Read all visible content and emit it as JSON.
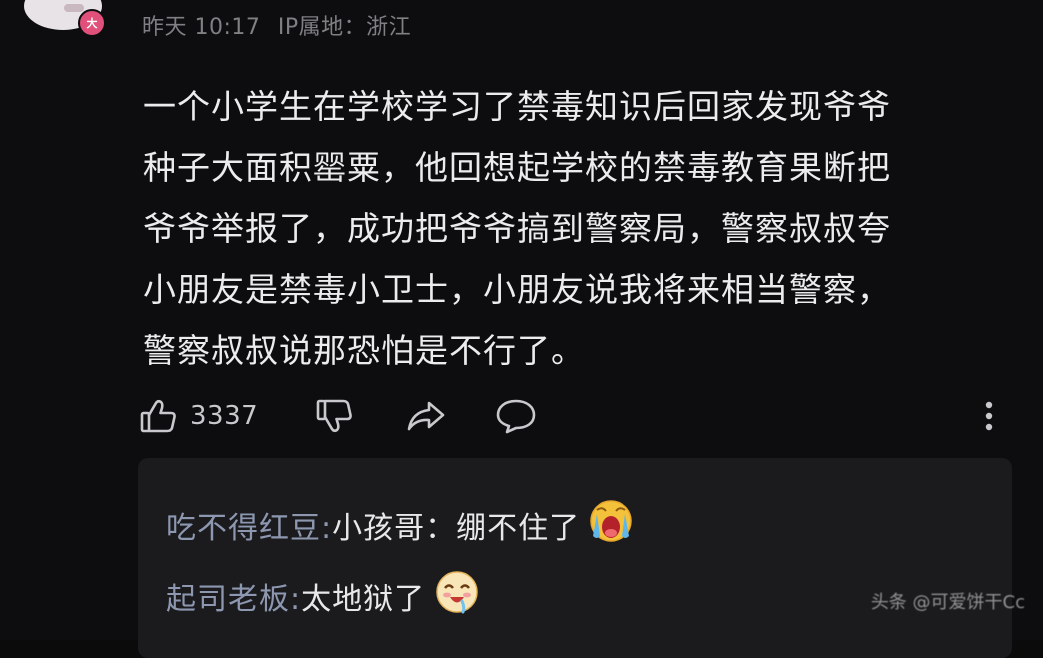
{
  "header": {
    "time": "昨天 10:17",
    "ip_location": "IP属地：浙江"
  },
  "comment": {
    "lines": [
      "一个小学生在学校学习了禁毒知识后回家发现爷爷",
      "种子大面积罂粟，他回想起学校的禁毒教育果断把",
      "爷爷举报了，成功把爷爷搞到警察局，警察叔叔夸",
      "小朋友是禁毒小卫士，小朋友说我将来相当警察，",
      "警察叔叔说那恐怕是不行了。"
    ]
  },
  "actions": {
    "like_count": "3337"
  },
  "replies": [
    {
      "name": "吃不得红豆:",
      "text": " 小孩哥：绷不住了",
      "emoji": "crying-emoji"
    },
    {
      "name": "起司老板:",
      "text": " 太地狱了",
      "emoji": "drooling-emoji"
    },
    {
      "name": "",
      "text": "",
      "emoji": ""
    }
  ],
  "watermark": "头条 @可爱饼干Cc",
  "colors": {
    "background": "#0d0d0f",
    "reply_box": "#1b1b1e",
    "reply_name": "#8d98b0",
    "text": "#ececee",
    "meta": "#7f7f84"
  }
}
